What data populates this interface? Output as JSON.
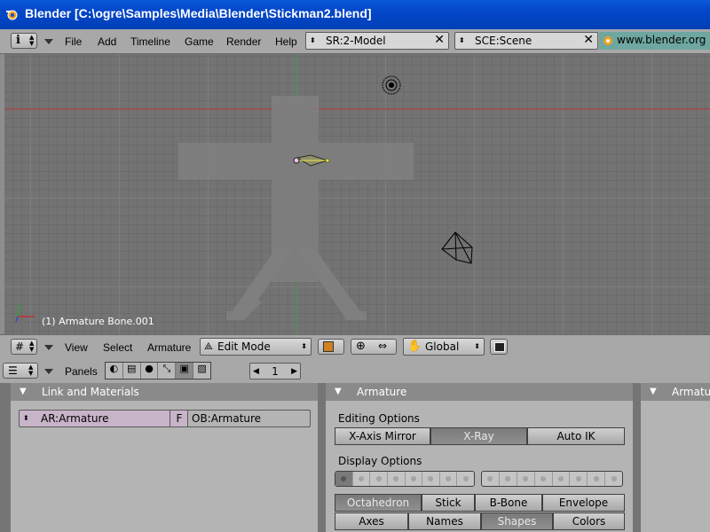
{
  "window": {
    "title": "Blender [C:\\ogre\\Samples\\Media\\Blender\\Stickman2.blend]"
  },
  "top_menu": {
    "items": [
      "File",
      "Add",
      "Timeline",
      "Game",
      "Render",
      "Help"
    ],
    "screen": "SR:2-Model",
    "scene": "SCE:Scene",
    "url": "www.blender.org 2"
  },
  "viewport": {
    "object_info": "(1) Armature Bone.001",
    "colors": {
      "bg": "#737373",
      "x_axis": "#b03030",
      "y_axis": "#30a030"
    }
  },
  "view3d_header": {
    "menus": [
      "View",
      "Select",
      "Armature"
    ],
    "mode": "Edit Mode",
    "orientation": "Global"
  },
  "buttons_header": {
    "panels_label": "Panels",
    "frame": "1"
  },
  "link_panel": {
    "title": "Link and Materials",
    "armature_field": "AR:Armature",
    "fake_user": "F",
    "object_field": "OB:Armature"
  },
  "armature_panel": {
    "title": "Armature",
    "editing_label": "Editing Options",
    "editing_buttons": [
      {
        "label": "X-Axis Mirror",
        "on": false
      },
      {
        "label": "X-Ray",
        "on": true
      },
      {
        "label": "Auto IK",
        "on": false
      }
    ],
    "display_label": "Display Options",
    "draw_types": [
      {
        "label": "Octahedron",
        "on": true
      },
      {
        "label": "Stick",
        "on": false
      },
      {
        "label": "B-Bone",
        "on": false
      },
      {
        "label": "Envelope",
        "on": false
      }
    ],
    "draw_flags": [
      {
        "label": "Axes",
        "on": false
      },
      {
        "label": "Names",
        "on": false
      },
      {
        "label": "Shapes",
        "on": true
      },
      {
        "label": "Colors",
        "on": false
      }
    ]
  },
  "third_panel": {
    "title": "Armatu"
  }
}
